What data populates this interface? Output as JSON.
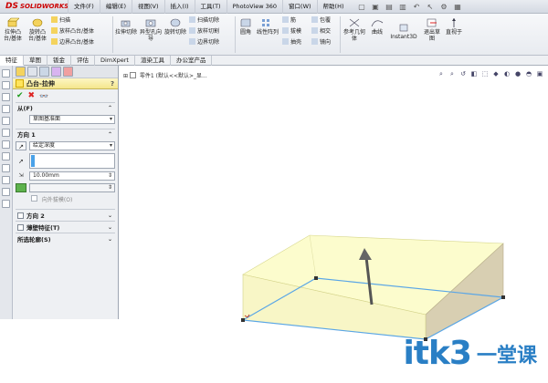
{
  "app": {
    "brand": "SOLIDWORKS",
    "brand_mark": "DS"
  },
  "menu": [
    "文件(F)",
    "编辑(E)",
    "视图(V)",
    "插入(I)",
    "工具(T)",
    "PhotoView 360",
    "窗口(W)",
    "帮助(H)"
  ],
  "ribbon": {
    "extrude_boss": "拉伸凸台/基体",
    "revolve_boss": "旋转凸台/基体",
    "sweep": "扫描",
    "loft_boss": "放样凸台/基体",
    "boundary_boss": "边界凸台/基体",
    "extrude_cut": "拉伸切除",
    "hole_wizard": "异型孔向导",
    "revolve_cut": "旋转切除",
    "swept_cut": "扫描切除",
    "lofted_cut": "放样切割",
    "boundary_cut": "边界切除",
    "fillet": "圆角",
    "linear_pattern": "线性阵列",
    "rib": "筋",
    "draft": "拔模",
    "shell": "抽壳",
    "wrap": "包覆",
    "intersect": "相交",
    "mirror": "镜向",
    "ref_geometry": "参考几何体",
    "curves": "曲线",
    "instant3d": "Instant3D",
    "exit_sketch": "退出草图",
    "smart_dim": "直视于"
  },
  "tabs": [
    "特征",
    "草图",
    "钣金",
    "评估",
    "DimXpert",
    "渲染工具",
    "办公室产品"
  ],
  "property_manager": {
    "title": "凸台-拉伸",
    "help": "?",
    "from": {
      "header": "从(F)",
      "value": "草图基准面"
    },
    "direction1": {
      "header": "方向 1",
      "end_condition": "给定深度",
      "depth": "10.00mm",
      "draft_outward": "向外拔模(O)"
    },
    "direction2": {
      "header": "方向 2"
    },
    "thin_feature": {
      "header": "薄壁特征(T)"
    },
    "selected_contours": {
      "header": "所选轮廓(S)"
    }
  },
  "graphics": {
    "tree_item": "零件1 (默认<<默认>_显...",
    "watermark": "itk3",
    "watermark_cn": "一堂课"
  },
  "colors": {
    "preview_face": "#fbfbc4",
    "preview_edge": "#5aa6e6",
    "accent_blue": "#2a7fc5"
  }
}
